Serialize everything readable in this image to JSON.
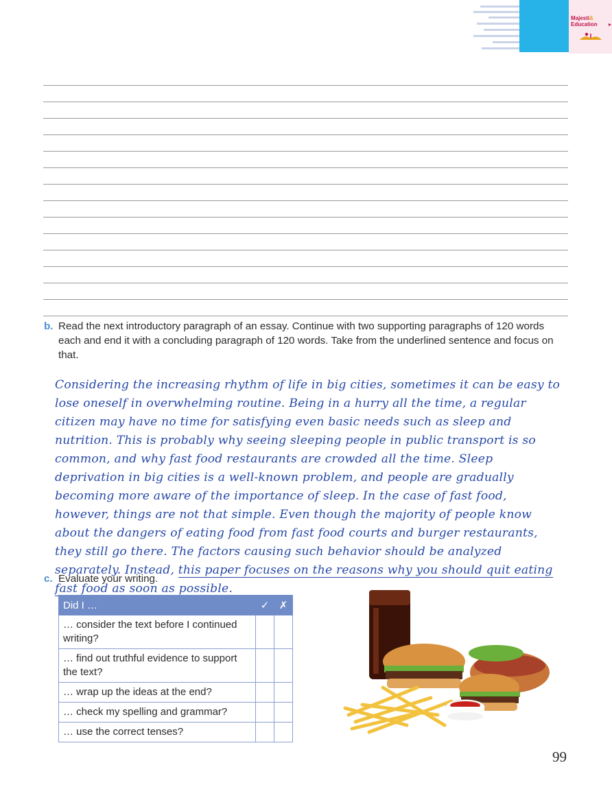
{
  "header": {
    "logo_line1": "Majesti",
    "logo_amp": "&",
    "logo_line2": "Education",
    "colors": {
      "blue_tab": "#27b3e8",
      "logo_bg": "#fbe8ef",
      "logo_text": "#c0144b"
    }
  },
  "writing_area": {
    "line_count": 14
  },
  "task_b": {
    "letter": "b.",
    "text": "Read the next introductory paragraph of an essay. Continue with two supporting paragraphs of 120 words each and end it with a concluding paragraph of 120 words. Take from the underlined sentence and focus on that."
  },
  "handwritten": {
    "text": "Considering the increasing rhythm of life in big cities, sometimes it can be easy to lose oneself in overwhelming routine. Being in a hurry all the time, a regular citizen may have no time for satisfying even basic needs such as sleep and nutrition. This is probably why seeing sleeping people in public transport is so common, and why fast food restaurants are crowded all the time. Sleep deprivation in big cities is a well-known problem, and people are gradually becoming more aware of the importance of sleep. In the case of fast food, however, things are not that simple. Even though the majority of people know about the dangers of eating food from fast food courts and burger restaurants, they still go there. The factors causing such behavior should be analyzed separately. Instead, ",
    "underlined": "this paper focuses on the reasons why you should quit eating fast food as soon as possible.",
    "ink_color": "#2749a8"
  },
  "task_c": {
    "letter": "c.",
    "text": "Evaluate your writing."
  },
  "eval_table": {
    "header": "Did I …",
    "check_symbol": "✓",
    "cross_symbol": "✗",
    "rows": [
      "… consider the text before I continued writing?",
      "… find out truthful evidence to support the text?",
      "… wrap up the ideas at the end?",
      "… check my spelling and grammar?",
      "… use the correct tenses?"
    ],
    "header_color": "#6f8cc8"
  },
  "food_image": {
    "icon": "fast-food-image"
  },
  "page_number": "99"
}
